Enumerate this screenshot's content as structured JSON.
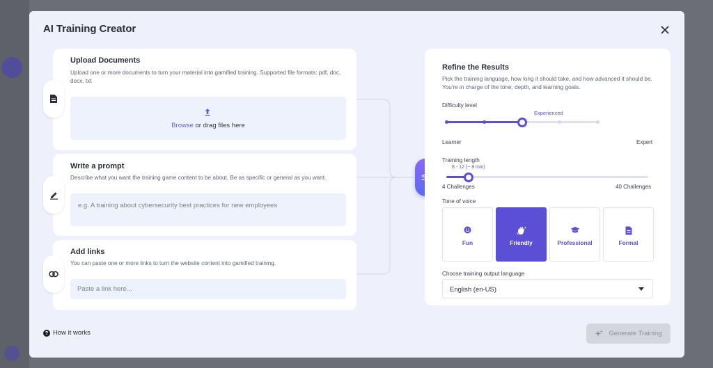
{
  "modal": {
    "title": "AI Training Creator",
    "close_icon": "close-icon"
  },
  "upload": {
    "title": "Upload Documents",
    "description": "Upload one or more documents to turn your material into gamified training. Supported file formats: pdf, doc, docx, txt",
    "browse_label": "Browse",
    "drag_label": " or drag files here",
    "icon": "document-icon"
  },
  "prompt": {
    "title": "Write a prompt",
    "description": "Describe what you want the training game content to be about. Be as specific or general as you want.",
    "placeholder": "e.g. A training about cybersecurity best practices for new employees",
    "icon": "pencil-icon"
  },
  "links": {
    "title": "Add links",
    "description": "You can paste one or more links to turn the website content into gamified training.",
    "placeholder": "Paste a link here...",
    "icon": "link-icon"
  },
  "refine": {
    "title": "Refine the Results",
    "description": "Pick the training language, how long it should take, and how advanced it should be. You're in charge of the tone, depth, and learning goals.",
    "difficulty": {
      "label": "Difficulty level",
      "min_label": "Learner",
      "max_label": "Expert",
      "current_label": "Experienced",
      "steps": 5,
      "current_step": 3
    },
    "length": {
      "label": "Training length",
      "value_label": "8 - 12 (~ 8 min)",
      "min_label": "4 Challenges",
      "max_label": "40 Challenges",
      "fraction": 0.11
    },
    "tone": {
      "label": "Tone of voice",
      "options": [
        {
          "label": "Fun",
          "icon": "smile-icon"
        },
        {
          "label": "Friendly",
          "icon": "wave-hand-icon"
        },
        {
          "label": "Professional",
          "icon": "graduation-cap-icon"
        },
        {
          "label": "Formal",
          "icon": "document-icon"
        }
      ],
      "selected": "Friendly"
    },
    "language": {
      "label": "Choose training output language",
      "value": "English (en-US)"
    }
  },
  "footer": {
    "how_label": "How it works",
    "generate_label": "Generate Training"
  },
  "colors": {
    "accent": "#5b4fd6",
    "modal_bg": "#eef1fb",
    "disabled": "#d4d6df"
  }
}
